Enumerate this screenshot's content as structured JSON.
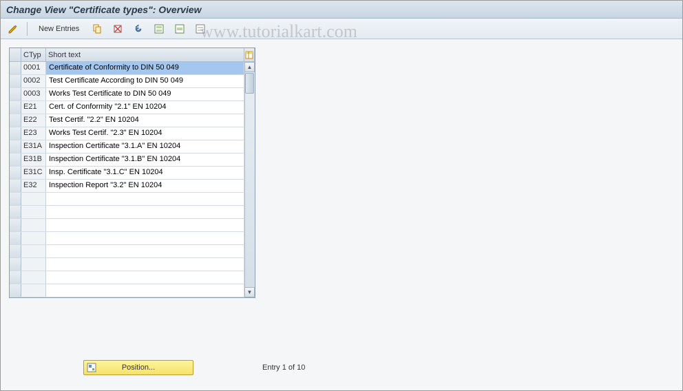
{
  "title": "Change View \"Certificate types\": Overview",
  "toolbar": {
    "new_entries_label": "New Entries"
  },
  "watermark": "www.tutorialkart.com",
  "grid": {
    "columns": {
      "ctyp": "CTyp",
      "short_text": "Short text"
    },
    "rows": [
      {
        "ctyp": "0001",
        "text": "Certificate of Conformity to DIN 50 049",
        "selected": true
      },
      {
        "ctyp": "0002",
        "text": "Test Certificate According to DIN 50 049",
        "selected": false
      },
      {
        "ctyp": "0003",
        "text": "Works Test Certificate  to DIN 50 049",
        "selected": false
      },
      {
        "ctyp": "E21",
        "text": "Cert. of Conformity \"2.1\"  EN 10204",
        "selected": false
      },
      {
        "ctyp": "E22",
        "text": "Test Certif. \"2.2\"        EN 10204",
        "selected": false
      },
      {
        "ctyp": "E23",
        "text": "Works Test Certif. \"2.3\"   EN 10204",
        "selected": false
      },
      {
        "ctyp": "E31A",
        "text": "Inspection Certificate \"3.1.A\"  EN 10204",
        "selected": false
      },
      {
        "ctyp": "E31B",
        "text": "Inspection Certificate \"3.1.B\"  EN 10204",
        "selected": false
      },
      {
        "ctyp": "E31C",
        "text": "Insp. Certificate \"3.1.C\"  EN 10204",
        "selected": false
      },
      {
        "ctyp": "E32",
        "text": "Inspection Report \"3.2\"    EN 10204",
        "selected": false
      }
    ],
    "empty_rows": 8
  },
  "footer": {
    "position_label": "Position...",
    "entry_text": "Entry 1 of 10"
  }
}
